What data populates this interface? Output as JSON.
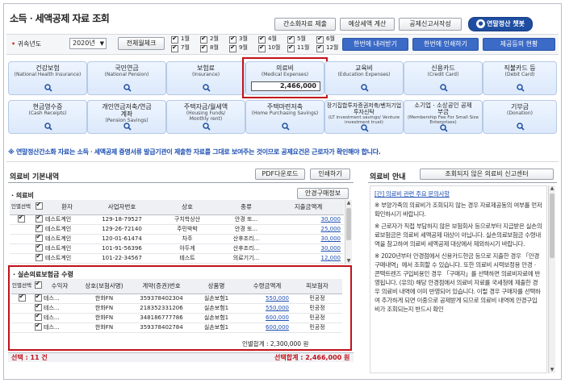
{
  "page": {
    "title": "소득ㆍ세액공제 자료 조회",
    "buttons": {
      "simplified_submit": "간소화자료 제출",
      "expected_tax": "예상세액 계산",
      "deduction_report": "공제신고서작성",
      "chatbot": "연말정산 챗봇"
    }
  },
  "filter": {
    "year_label": "귀속년도",
    "year_value": "2020년",
    "select_all": "전체월체크",
    "months": [
      "1월",
      "2월",
      "3월",
      "4월",
      "5월",
      "6월",
      "7월",
      "8월",
      "9월",
      "10월",
      "11월",
      "12월"
    ],
    "download_all": "한번에 내려받기",
    "print_all": "한번에 인쇄하기",
    "deduction_status": "제공등의 현황"
  },
  "cards": [
    {
      "ko": "건강보험",
      "en": "(National Health Insurance)"
    },
    {
      "ko": "국민연금",
      "en": "(National Pension)"
    },
    {
      "ko": "보험료",
      "en": "(Insurance)"
    },
    {
      "ko": "의료비",
      "en": "(Medical Expenses)",
      "value": "2,466,000"
    },
    {
      "ko": "교육비",
      "en": "(Education Expenses)"
    },
    {
      "ko": "신용카드",
      "en": "(Credit Card)"
    },
    {
      "ko": "직불카드 등",
      "en": "(Debit Card)"
    },
    {
      "ko": "현금영수증",
      "en": "(Cash Receipts)"
    },
    {
      "ko": "개인연금저축/연금계좌",
      "en": "(Pension Savings)"
    },
    {
      "ko": "주택자금/월세액",
      "en": "(Housing Funds/ Monthly rent)"
    },
    {
      "ko": "주택마련저축",
      "en": "(Home Purchasing Savings)"
    },
    {
      "ko": "장기집합투자증권저축/벤처기업투자신탁",
      "en": "(LT investment savings/ Venture investment trust)"
    },
    {
      "ko": "소기업ㆍ소상공인 공제부금",
      "en": "(Membership Fee For Small Size Enterprises)"
    },
    {
      "ko": "기부금",
      "en": "(Donation)"
    }
  ],
  "notice": "※ 연말정산간소화 자료는 소득ㆍ세액공제 증명서류 발급기관이 제출한 자료를 그대로 보여주는 것이므로 공제요건은 근로자가 확인해야 합니다.",
  "medical": {
    "section_title": "의료비 기본내역",
    "pdf_button": "PDF다운로드",
    "print_button": "인쇄하기",
    "sub_title": "· 의료비",
    "pharmacy_button": "안경구매정보",
    "columns": [
      "인별선택",
      "",
      "환자",
      "사업자번호",
      "상호",
      "종류",
      "지출금액계"
    ],
    "rows": [
      {
        "patient": "테스트계인",
        "bizno": "129-18-79527",
        "name": "구치학상산",
        "type": "안경 또...",
        "amount": "30,000"
      },
      {
        "patient": "테스트계인",
        "bizno": "129-26-72140",
        "name": "주민박박",
        "type": "안경 또...",
        "amount": "25,000"
      },
      {
        "patient": "테스트계인",
        "bizno": "120-01-61474",
        "name": "차주",
        "type": "산후조리...",
        "amount": "30,000"
      },
      {
        "patient": "테스트계인",
        "bizno": "101-91-56396",
        "name": "아두게",
        "type": "산후조리...",
        "amount": "30,000"
      },
      {
        "patient": "테스트계인",
        "bizno": "101-22-34567",
        "name": "테스트",
        "type": "의료기기...",
        "amount": "12,000"
      }
    ]
  },
  "insurance": {
    "sub_title": "· 실손의료보험금 수령",
    "columns": [
      "인별선택",
      "",
      "수익자",
      "상호(보험사명)",
      "계약(증권)번호",
      "상품명",
      "수령금액계",
      "피보험자"
    ],
    "rows": [
      {
        "beneficiary": "테스...",
        "company": "한화FN",
        "contract": "359378402304",
        "product": "실손보험1",
        "amount": "550,000",
        "insured": "민공정"
      },
      {
        "beneficiary": "테스...",
        "company": "한화FN",
        "contract": "218352331206",
        "product": "실손보험1",
        "amount": "550,000",
        "insured": "민공정"
      },
      {
        "beneficiary": "테스...",
        "company": "한화FN",
        "contract": "348186777786",
        "product": "실손보험1",
        "amount": "600,000",
        "insured": "민공정"
      },
      {
        "beneficiary": "테스...",
        "company": "한화FN",
        "contract": "359378402784",
        "product": "실손보험1",
        "amount": "600,000",
        "insured": "민공정"
      }
    ],
    "total_label": "인별합계 : 2,300,000 원"
  },
  "footer": {
    "selected": "선택 : 11 건",
    "selected_total": "선택합계 : 2,466,000 원"
  },
  "guide": {
    "title": "의료비 안내",
    "unqueried_button": "조회되지 않은 의료비 신고센터",
    "faq_link": "[간] 의료비 관련 주요 문의사항",
    "paragraphs": [
      "※ 부양가족의 의료비가 조회되지 않는 경우 자료제공동의 여부를 먼저 확인하시기 바랍니다.",
      "※ 근로자가 직접 부담하지 않은 보험회사 등으로부터 지급받은 실손의료보험금은 의료비 세액공제 대상이 아닙니다. 실손의료보험금 수령내역을 참고하여 의료비 세액공제 대상에서 제외하시기 바랍니다.",
      "※ 2020년부터 안경점에서 신용카드현금 등으로 지출한 경우 「안경구매내역」에서 조회할 수 있습니다. 또한 의료비 시력보정용 안경ㆍ콘택트렌즈 구입비용인 경우 「구매자」를 선택하면 의료비자료에 반영됩니다. (유의) 해당 안경점에서 의료비 자료를 국세청에 제출한 경우 의료비 내역에 이미 반영되어 있습니다. 이럴 경우 구매자를 선택하여 추가하게 되면 이중으로 공제받게 되므로 의료비 내역에 안경구입비가 조회되는지 반드시 확인"
    ]
  }
}
